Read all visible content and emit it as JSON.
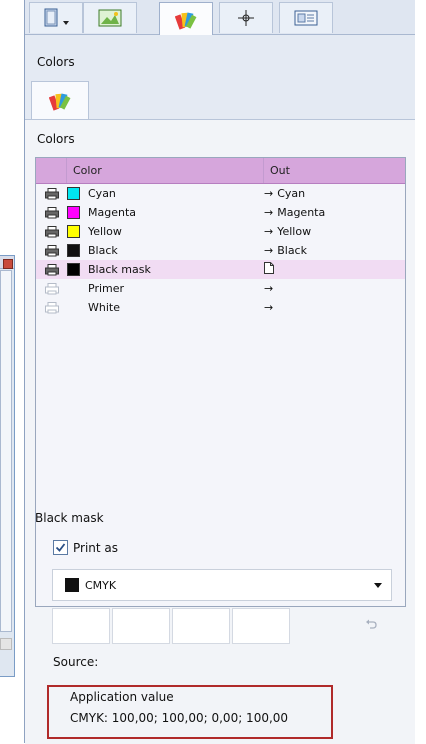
{
  "panel": {
    "section_title": "Colors",
    "list_title": "Colors",
    "columns": {
      "color": "Color",
      "out": "Out"
    }
  },
  "rows": [
    {
      "name": "Cyan",
      "swatch": "#00e6f0",
      "out": "Cyan",
      "print": "on"
    },
    {
      "name": "Magenta",
      "swatch": "#ff00ff",
      "out": "Magenta",
      "print": "on"
    },
    {
      "name": "Yellow",
      "swatch": "#ffff00",
      "out": "Yellow",
      "print": "on"
    },
    {
      "name": "Black",
      "swatch": "#111111",
      "out": "Black",
      "print": "on"
    },
    {
      "name": "Black mask",
      "swatch": "#000000",
      "out": "",
      "print": "on",
      "selected": true
    },
    {
      "name": "Primer",
      "swatch": "",
      "out": "",
      "print": "off"
    },
    {
      "name": "White",
      "swatch": "",
      "out": "",
      "print": "off"
    }
  ],
  "detail": {
    "title": "Black mask",
    "print_as_label": "Print as",
    "print_as_checked": true,
    "select_value": "CMYK",
    "source_label": "Source:",
    "app_value_label": "Application value",
    "cmyk_values": "CMYK:  100,00; 100,00; 0,00; 100,00"
  },
  "colors": {
    "header": "#d6a6dc",
    "selected_row": "#f1dcf3",
    "highlight_border": "#b02a2a"
  }
}
